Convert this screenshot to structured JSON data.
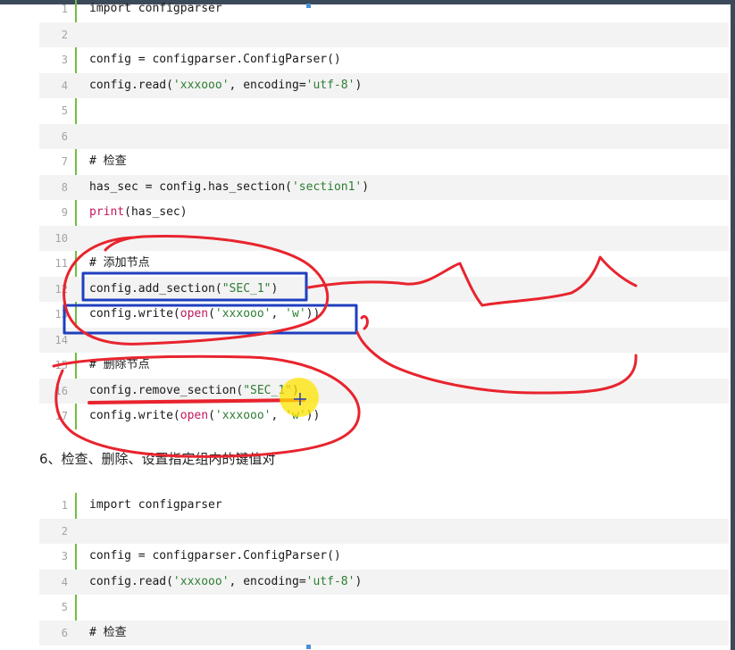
{
  "block1": {
    "lines": [
      {
        "n": "1",
        "parts": [
          {
            "t": "import configparser"
          }
        ]
      },
      {
        "n": "2",
        "parts": []
      },
      {
        "n": "3",
        "parts": [
          {
            "t": "config = configparser.ConfigParser()"
          }
        ]
      },
      {
        "n": "4",
        "parts": [
          {
            "t": "config.read("
          },
          {
            "t": "'xxxooo'",
            "c": "str"
          },
          {
            "t": ", encoding="
          },
          {
            "t": "'utf-8'",
            "c": "str"
          },
          {
            "t": ")"
          }
        ]
      },
      {
        "n": "5",
        "parts": []
      },
      {
        "n": "6",
        "parts": []
      },
      {
        "n": "7",
        "parts": [
          {
            "t": "# 检查"
          }
        ]
      },
      {
        "n": "8",
        "parts": [
          {
            "t": "has_sec = config.has_section("
          },
          {
            "t": "'section1'",
            "c": "str"
          },
          {
            "t": ")"
          }
        ]
      },
      {
        "n": "9",
        "parts": [
          {
            "t": "print",
            "c": "kw"
          },
          {
            "t": "(has_sec)"
          }
        ]
      },
      {
        "n": "10",
        "parts": []
      },
      {
        "n": "11",
        "parts": [
          {
            "t": "# 添加节点"
          }
        ]
      },
      {
        "n": "12",
        "parts": [
          {
            "t": "config.add_section("
          },
          {
            "t": "\"SEC_1\"",
            "c": "str"
          },
          {
            "t": ")"
          }
        ]
      },
      {
        "n": "13",
        "parts": [
          {
            "t": "config.write("
          },
          {
            "t": "open",
            "c": "kw"
          },
          {
            "t": "("
          },
          {
            "t": "'xxxooo'",
            "c": "str"
          },
          {
            "t": ", "
          },
          {
            "t": "'w'",
            "c": "str"
          },
          {
            "t": "))"
          }
        ]
      },
      {
        "n": "14",
        "parts": []
      },
      {
        "n": "15",
        "parts": [
          {
            "t": "# 删除节点"
          }
        ]
      },
      {
        "n": "16",
        "parts": [
          {
            "t": "config.remove_section("
          },
          {
            "t": "\"SEC_1\"",
            "c": "str"
          },
          {
            "t": ")"
          }
        ]
      },
      {
        "n": "17",
        "parts": [
          {
            "t": "config.write("
          },
          {
            "t": "open",
            "c": "kw"
          },
          {
            "t": "("
          },
          {
            "t": "'xxxooo'",
            "c": "str"
          },
          {
            "t": ", "
          },
          {
            "t": "'w'",
            "c": "str"
          },
          {
            "t": "))"
          }
        ]
      }
    ]
  },
  "section_heading": "6、检查、删除、设置指定组内的键值对",
  "block2": {
    "lines": [
      {
        "n": "1",
        "parts": [
          {
            "t": "import configparser"
          }
        ]
      },
      {
        "n": "2",
        "parts": []
      },
      {
        "n": "3",
        "parts": [
          {
            "t": "config = configparser.ConfigParser()"
          }
        ]
      },
      {
        "n": "4",
        "parts": [
          {
            "t": "config.read("
          },
          {
            "t": "'xxxooo'",
            "c": "str"
          },
          {
            "t": ", encoding="
          },
          {
            "t": "'utf-8'",
            "c": "str"
          },
          {
            "t": ")"
          }
        ]
      },
      {
        "n": "5",
        "parts": []
      },
      {
        "n": "6",
        "parts": [
          {
            "t": "# 检查"
          }
        ]
      }
    ]
  },
  "colors": {
    "keyword": "#c2185b",
    "string": "#2e7d32",
    "gutter": "#6fbf3f",
    "annotation_red": "#e8242e",
    "annotation_blue": "#1f3fbf"
  }
}
